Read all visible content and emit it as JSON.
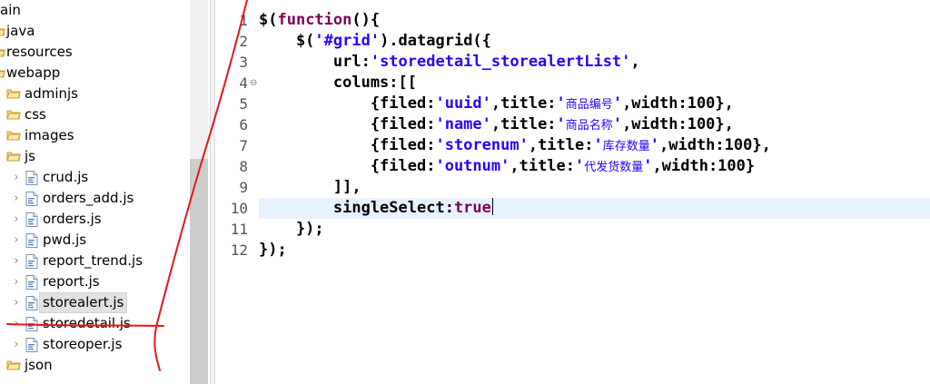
{
  "explorer": {
    "items": [
      {
        "label": "ain",
        "kind": "folder-partial",
        "indent": 0,
        "twisty": "",
        "selected": false
      },
      {
        "label": "java",
        "kind": "java-folder",
        "indent": 0,
        "twisty": "",
        "selected": false
      },
      {
        "label": "resources",
        "kind": "java-folder",
        "indent": 0,
        "twisty": "",
        "selected": false
      },
      {
        "label": "webapp",
        "kind": "java-folder",
        "indent": 0,
        "twisty": "",
        "selected": false
      },
      {
        "label": "adminjs",
        "kind": "folder",
        "indent": 1,
        "twisty": "",
        "selected": false
      },
      {
        "label": "css",
        "kind": "folder",
        "indent": 1,
        "twisty": "",
        "selected": false
      },
      {
        "label": "images",
        "kind": "folder",
        "indent": 1,
        "twisty": "",
        "selected": false
      },
      {
        "label": "js",
        "kind": "folder",
        "indent": 1,
        "twisty": "",
        "selected": false
      },
      {
        "label": "crud.js",
        "kind": "js-file",
        "indent": 2,
        "twisty": "›",
        "selected": false
      },
      {
        "label": "orders_add.js",
        "kind": "js-file",
        "indent": 2,
        "twisty": "›",
        "selected": false
      },
      {
        "label": "orders.js",
        "kind": "js-file",
        "indent": 2,
        "twisty": "›",
        "selected": false
      },
      {
        "label": "pwd.js",
        "kind": "js-file",
        "indent": 2,
        "twisty": "›",
        "selected": false
      },
      {
        "label": "report_trend.js",
        "kind": "js-file",
        "indent": 2,
        "twisty": "›",
        "selected": false
      },
      {
        "label": "report.js",
        "kind": "js-file",
        "indent": 2,
        "twisty": "›",
        "selected": false
      },
      {
        "label": "storealert.js",
        "kind": "js-file",
        "indent": 2,
        "twisty": "›",
        "selected": true
      },
      {
        "label": "storedetail.js",
        "kind": "js-file",
        "indent": 2,
        "twisty": "›",
        "selected": false
      },
      {
        "label": "storeoper.js",
        "kind": "js-file",
        "indent": 2,
        "twisty": "›",
        "selected": false
      },
      {
        "label": "json",
        "kind": "folder",
        "indent": 1,
        "twisty": "",
        "selected": false
      }
    ]
  },
  "editor": {
    "fold_marker": "⊖",
    "current_line": 10,
    "colors": {
      "keyword": "#7f0055",
      "string": "#2a00ff",
      "plain": "#000000",
      "current_line_bg": "#e8f2fe"
    },
    "lines": [
      {
        "no": "1",
        "fold": false,
        "segs": [
          {
            "t": "$(",
            "c": "plain"
          },
          {
            "t": "function",
            "c": "keyword"
          },
          {
            "t": "(){",
            "c": "plain"
          }
        ]
      },
      {
        "no": "2",
        "fold": false,
        "segs": [
          {
            "t": "    $(",
            "c": "plain"
          },
          {
            "t": "'#grid'",
            "c": "string"
          },
          {
            "t": ").datagrid({",
            "c": "plain"
          }
        ]
      },
      {
        "no": "3",
        "fold": false,
        "segs": [
          {
            "t": "        url:",
            "c": "plain"
          },
          {
            "t": "'storedetail_storealertList'",
            "c": "string"
          },
          {
            "t": ",",
            "c": "plain"
          }
        ]
      },
      {
        "no": "4",
        "fold": true,
        "segs": [
          {
            "t": "        colums:[[",
            "c": "plain"
          }
        ]
      },
      {
        "no": "5",
        "fold": false,
        "segs": [
          {
            "t": "            {filed:",
            "c": "plain"
          },
          {
            "t": "'uuid'",
            "c": "string"
          },
          {
            "t": ",title:",
            "c": "plain"
          },
          {
            "t": "'",
            "c": "string"
          },
          {
            "t": "商品编号",
            "c": "string",
            "cjk": true
          },
          {
            "t": "'",
            "c": "string"
          },
          {
            "t": ",width:100},",
            "c": "plain"
          }
        ]
      },
      {
        "no": "6",
        "fold": false,
        "segs": [
          {
            "t": "            {filed:",
            "c": "plain"
          },
          {
            "t": "'name'",
            "c": "string"
          },
          {
            "t": ",title:",
            "c": "plain"
          },
          {
            "t": "'",
            "c": "string"
          },
          {
            "t": "商品名称",
            "c": "string",
            "cjk": true
          },
          {
            "t": "'",
            "c": "string"
          },
          {
            "t": ",width:100},",
            "c": "plain"
          }
        ]
      },
      {
        "no": "7",
        "fold": false,
        "segs": [
          {
            "t": "            {filed:",
            "c": "plain"
          },
          {
            "t": "'storenum'",
            "c": "string"
          },
          {
            "t": ",title:",
            "c": "plain"
          },
          {
            "t": "'",
            "c": "string"
          },
          {
            "t": "库存数量",
            "c": "string",
            "cjk": true
          },
          {
            "t": "'",
            "c": "string"
          },
          {
            "t": ",width:100},",
            "c": "plain"
          }
        ]
      },
      {
        "no": "8",
        "fold": false,
        "segs": [
          {
            "t": "            {filed:",
            "c": "plain"
          },
          {
            "t": "'outnum'",
            "c": "string"
          },
          {
            "t": ",title:",
            "c": "plain"
          },
          {
            "t": "'",
            "c": "string"
          },
          {
            "t": "代发货数量",
            "c": "string",
            "cjk": true
          },
          {
            "t": "'",
            "c": "string"
          },
          {
            "t": ",width:100}",
            "c": "plain"
          }
        ]
      },
      {
        "no": "9",
        "fold": false,
        "segs": [
          {
            "t": "        ]],",
            "c": "plain"
          }
        ]
      },
      {
        "no": "10",
        "fold": false,
        "segs": [
          {
            "t": "        singleSelect:",
            "c": "plain"
          },
          {
            "t": "true",
            "c": "keyword"
          }
        ]
      },
      {
        "no": "11",
        "fold": false,
        "segs": [
          {
            "t": "    });",
            "c": "plain"
          }
        ]
      },
      {
        "no": "12",
        "fold": false,
        "segs": [
          {
            "t": "});",
            "c": "plain"
          }
        ]
      }
    ]
  },
  "annotation_color": "#e8141b"
}
